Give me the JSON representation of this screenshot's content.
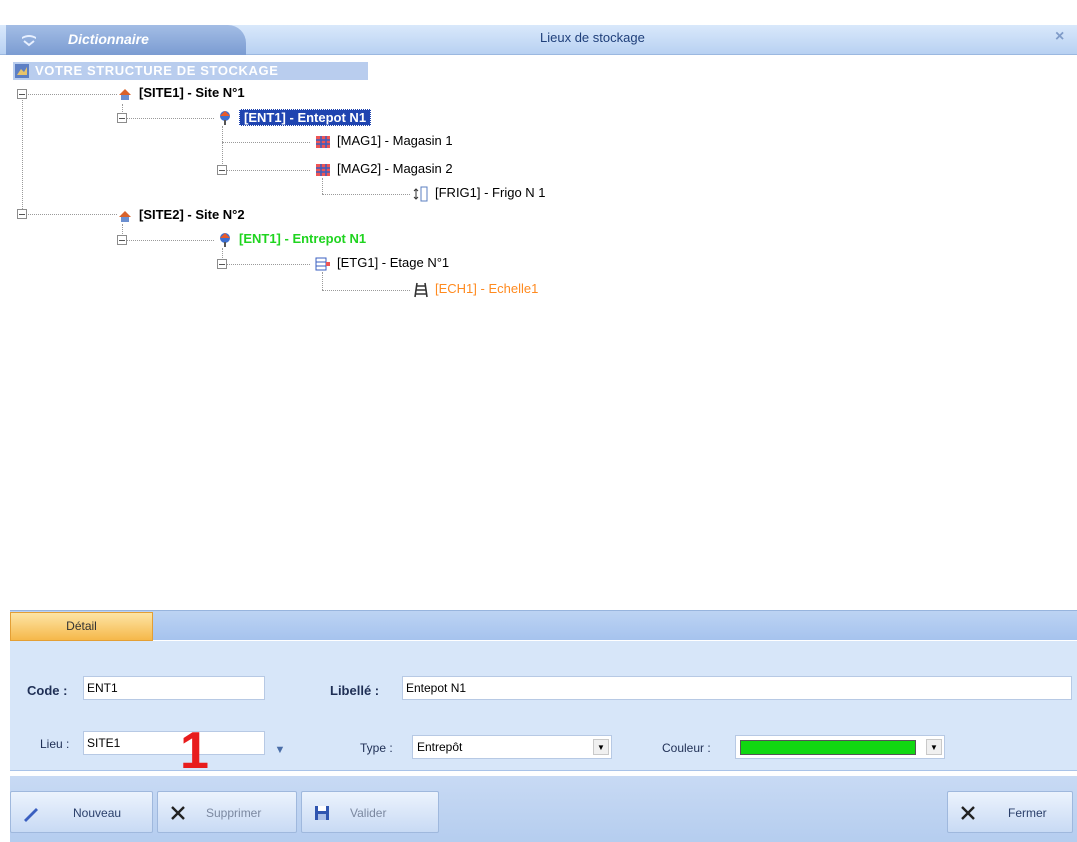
{
  "titlebar": {
    "dict_tab": "Dictionnaire",
    "title": "Lieux de stockage",
    "close": "×"
  },
  "tree": {
    "root": "VOTRE STRUCTURE DE STOCKAGE",
    "nodes": [
      {
        "label": "[SITE1] - Site N°1",
        "icon": "site-icon"
      },
      {
        "label": "[ENT1] - Entepot N1",
        "icon": "warehouse-icon",
        "selected": true
      },
      {
        "label": "[MAG1] - Magasin 1",
        "icon": "store-icon"
      },
      {
        "label": "[MAG2] - Magasin 2",
        "icon": "store-icon"
      },
      {
        "label": "[FRIG1] - Frigo N 1",
        "icon": "fridge-icon"
      },
      {
        "label": "[SITE2] - Site N°2",
        "icon": "site-icon"
      },
      {
        "label": "[ENT1] - Entrepot N1",
        "icon": "warehouse-icon",
        "color": "#1fd41f"
      },
      {
        "label": "[ETG1] - Etage N°1",
        "icon": "floor-icon"
      },
      {
        "label": "[ECH1] - Echelle1",
        "icon": "ladder-icon",
        "color": "#ff8a1f"
      }
    ]
  },
  "detail": {
    "tab": "Détail",
    "code_label": "Code :",
    "code_value": "ENT1",
    "libelle_label": "Libellé :",
    "libelle_value": "Entepot N1",
    "lieu_label": "Lieu :",
    "lieu_value": "SITE1",
    "type_label": "Type :",
    "type_value": "Entrepôt",
    "couleur_label": "Couleur :",
    "couleur_value": "#11d811",
    "marker": "1"
  },
  "buttons": {
    "nouveau": "Nouveau",
    "supprimer": "Supprimer",
    "valider": "Valider",
    "fermer": "Fermer"
  }
}
